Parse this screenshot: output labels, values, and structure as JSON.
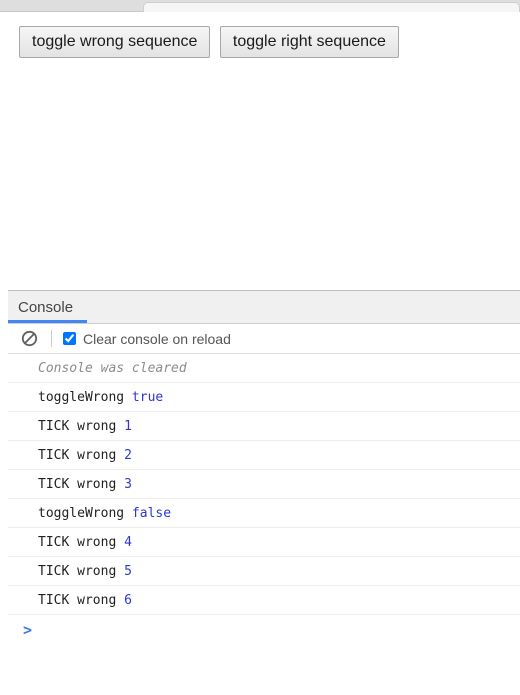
{
  "browser": {
    "tab_strip_label": "browser-tab-strip"
  },
  "page": {
    "buttons": [
      {
        "label": "toggle wrong sequence",
        "name": "toggle-wrong-sequence-button"
      },
      {
        "label": "toggle right sequence",
        "name": "toggle-right-sequence-button"
      }
    ]
  },
  "devtools": {
    "tabs": [
      {
        "label": "Console",
        "active": true
      }
    ],
    "toolbar": {
      "clear_console_icon": "clear-console-icon",
      "clear_on_reload_label": "Clear console on reload",
      "clear_on_reload_checked": true
    },
    "accent_color": "#4286f5",
    "value_color": "#2f36d6",
    "prompt_symbol": ">",
    "log": [
      {
        "text": "Console was cleared",
        "value": "",
        "style": "cleared"
      },
      {
        "text": "toggleWrong ",
        "value": "true",
        "style": "normal"
      },
      {
        "text": "TICK wrong ",
        "value": "1",
        "style": "normal"
      },
      {
        "text": "TICK wrong ",
        "value": "2",
        "style": "normal"
      },
      {
        "text": "TICK wrong ",
        "value": "3",
        "style": "normal"
      },
      {
        "text": "toggleWrong ",
        "value": "false",
        "style": "normal"
      },
      {
        "text": "TICK wrong ",
        "value": "4",
        "style": "normal"
      },
      {
        "text": "TICK wrong ",
        "value": "5",
        "style": "normal"
      },
      {
        "text": "TICK wrong ",
        "value": "6",
        "style": "normal"
      }
    ]
  }
}
